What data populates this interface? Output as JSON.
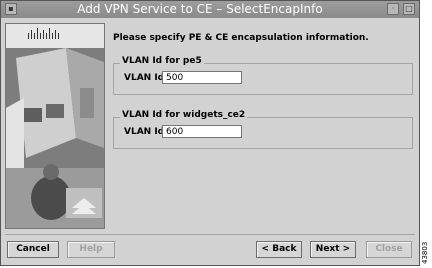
{
  "window": {
    "title": "Add VPN Service to CE – SelectEncapInfo"
  },
  "titlebar_icons": [
    "minimize-icon",
    "maximize-icon",
    "close-icon"
  ],
  "main": {
    "instruction": "Please specify PE & CE encapsulation information.",
    "groups": [
      {
        "title": "VLAN Id for pe5",
        "label": "VLAN Id:",
        "value": "500"
      },
      {
        "title": "VLAN Id for widgets_ce2",
        "label": "VLAN Id:",
        "value": "600"
      }
    ]
  },
  "buttons": {
    "cancel": "Cancel",
    "help": "Help",
    "back": "< Back",
    "next": "Next >",
    "close": "Close"
  },
  "figure_id": "43803",
  "colors": {
    "titlebar": "#939393",
    "background": "#d2d2d2",
    "disabled_text": "#a2a2a2"
  }
}
